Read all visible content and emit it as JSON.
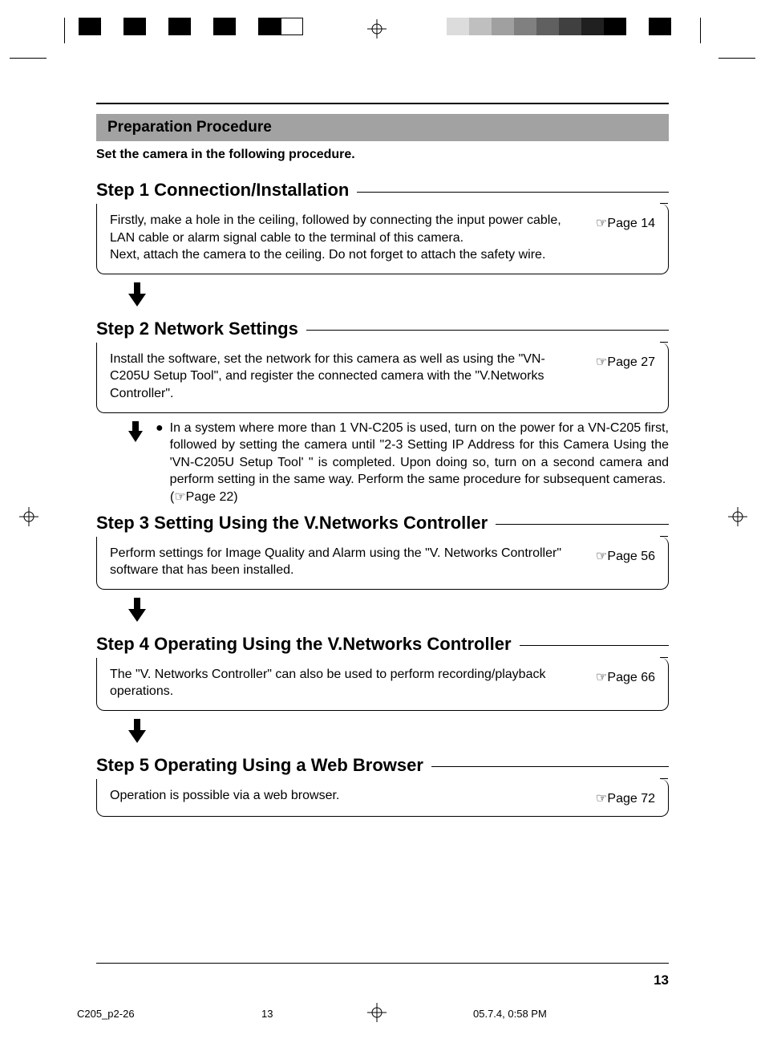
{
  "header": {
    "title": "Preparation Procedure",
    "intro": "Set the camera in the following procedure."
  },
  "steps": [
    {
      "title": "Step 1 Connection/Installation",
      "body": "Firstly, make a hole in the ceiling, followed by connecting the input power cable, LAN cable or alarm signal cable to the terminal of this camera.\nNext, attach the camera to the ceiling. Do not forget to attach the safety wire.",
      "ref": "☞Page 14"
    },
    {
      "title": "Step 2 Network Settings",
      "body": "Install the software, set the network for this camera as well as using the \"VN-C205U Setup Tool\", and register the connected camera with the \"V.Networks Controller\".",
      "ref": "☞Page 27"
    },
    {
      "title": "Step 3 Setting Using the V.Networks Controller",
      "body": "Perform settings for  Image Quality and Alarm  using the \"V. Networks Controller\" software that has been installed.",
      "ref": "☞Page 56"
    },
    {
      "title": "Step 4 Operating Using the V.Networks Controller",
      "body": "The \"V. Networks Controller\" can also be used to perform recording/playback operations.",
      "ref": "☞Page 66"
    },
    {
      "title": "Step 5 Operating Using a Web Browser",
      "body": "Operation is possible via a web browser.",
      "ref": "☞Page 72"
    }
  ],
  "note": {
    "bullet": "●",
    "text": "In a system where more than 1 VN-C205 is used, turn on the power for a VN-C205 first, followed by setting the camera until \"2-3 Setting IP Address for this Camera Using the 'VN-C205U Setup Tool' \" is completed. Upon doing so, turn on a second camera and perform setting in the same way. Perform the same procedure for subsequent cameras.",
    "ref": "(☞Page 22)"
  },
  "footer": {
    "page_number": "13",
    "file": "C205_p2-26",
    "sheet": "13",
    "timestamp": "05.7.4, 0:58 PM"
  }
}
